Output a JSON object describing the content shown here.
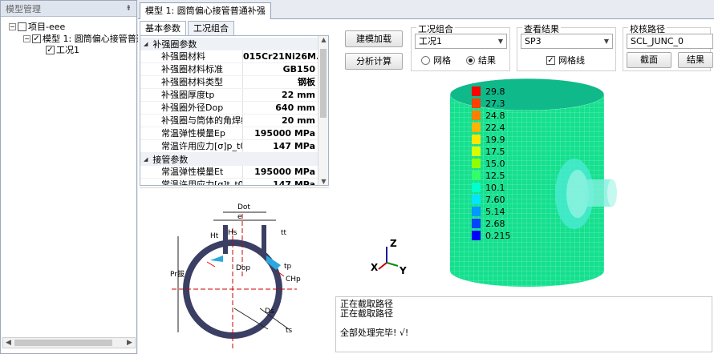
{
  "tree": {
    "header": "模型管理",
    "pin": "⇞",
    "items": [
      {
        "label": "项目-eee",
        "expander": "⊟"
      },
      {
        "label": "模型 1: 圆筒偏心接管普通补强",
        "expander": "⊟"
      },
      {
        "label": "工况1",
        "expander": ""
      }
    ]
  },
  "main_tab": "模型 1: 圆筒偏心接管普通补强",
  "sub_tabs": [
    "基本参数",
    "工况组合"
  ],
  "properties": {
    "cat1": "补强圈参数",
    "rows1": [
      {
        "name": "补强圈材料",
        "value": "015Cr21Ni26M..."
      },
      {
        "name": "补强圈材料标准",
        "value": "GB150"
      },
      {
        "name": "补强圈材料类型",
        "value": "钢板"
      },
      {
        "name": "补强圈厚度tp",
        "value": "22 mm"
      },
      {
        "name": "补强圈外径Dop",
        "value": "640 mm"
      },
      {
        "name": "补强圈与筒体的角焊缝",
        "value": "20 mm"
      },
      {
        "name": "常温弹性模量Ep",
        "value": "195000 MPa"
      },
      {
        "name": "常温许用应力[σ]p_t0",
        "value": "147 MPa"
      }
    ],
    "cat2": "接管参数",
    "rows2": [
      {
        "name": "常温弹性模量Et",
        "value": "195000 MPa"
      },
      {
        "name": "常温许用应力[σ]t_t0",
        "value": "147 MPa"
      }
    ]
  },
  "diagram_labels": {
    "dot": "Dot",
    "e": "e",
    "ht": "Ht",
    "hs": "Hs",
    "tt": "tt",
    "prj": "Pr拔",
    "dop": "Dop",
    "tp": "tp",
    "chp": "CHp",
    "ds": "Ds",
    "ts": "ts"
  },
  "toolbar": {
    "build_load": "建模加载",
    "analyze": "分析计算",
    "case_combo_label": "工况组合",
    "case_select": "工况1",
    "radio_mesh": "网格",
    "radio_result": "结果",
    "view_result_label": "查看结果",
    "result_select": "SP3",
    "grid_check": "网格线",
    "verify_path_label": "校核路径",
    "path_select": "SCL_JUNC_0",
    "section_btn": "截面",
    "result_btn": "结果"
  },
  "axis": {
    "z": "Z",
    "x": "X",
    "y": "Y"
  },
  "legend": {
    "values": [
      "29.8",
      "27.3",
      "24.8",
      "22.4",
      "19.9",
      "17.5",
      "15.0",
      "12.5",
      "10.1",
      "7.60",
      "5.14",
      "2.68",
      "0.215"
    ],
    "colors": [
      "#ff0000",
      "#ff4000",
      "#ff8000",
      "#ffb400",
      "#ffe600",
      "#d8ff00",
      "#90ff00",
      "#33ff66",
      "#00ffcc",
      "#00e6ff",
      "#0099ff",
      "#0044ff",
      "#0000ff"
    ]
  },
  "log_lines": [
    "正在截取路径",
    "正在截取路径",
    "",
    "全部处理完毕! √!"
  ]
}
